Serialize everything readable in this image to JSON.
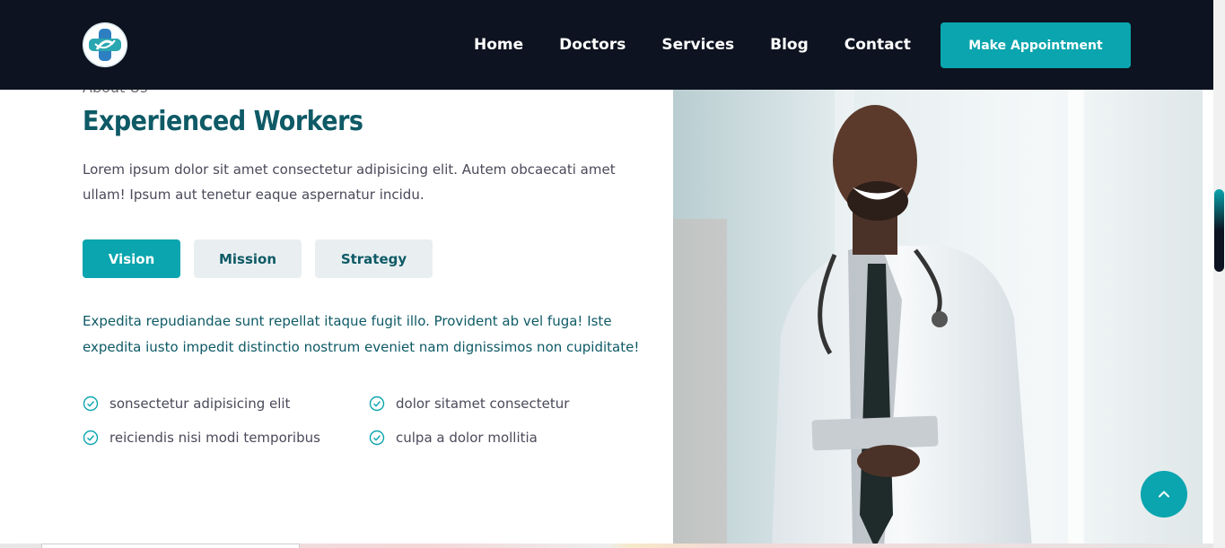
{
  "header": {
    "nav": [
      "Home",
      "Doctors",
      "Services",
      "Blog",
      "Contact"
    ],
    "cta_label": "Make Appointment"
  },
  "about": {
    "eyebrow": "About Us",
    "title": "Experienced Workers",
    "intro": "Lorem ipsum dolor sit amet consectetur adipisicing elit. Autem obcaecati amet ullam! Ipsum aut tenetur eaque aspernatur incidu.",
    "tabs": [
      "Vision",
      "Mission",
      "Strategy"
    ],
    "active_tab": "Vision",
    "tab_text": "Expedita repudiandae sunt repellat itaque fugit illo. Provident ab vel fuga! Iste expedita iusto impedit distinctio nostrum eveniet nam dignissimos non cupiditate!",
    "features": [
      "sonsectetur adipisicing elit",
      "dolor sitamet consectetur",
      "reiciendis nisi modi temporibus",
      "culpa a dolor mollitia"
    ]
  },
  "colors": {
    "header_bg": "#0d1320",
    "accent": "#0aa5ae",
    "heading": "#0e5a66"
  },
  "icons": {
    "logo": "medical-cross-logo-icon",
    "feature": "check-circle-icon",
    "scroll_top": "chevron-up-icon"
  }
}
